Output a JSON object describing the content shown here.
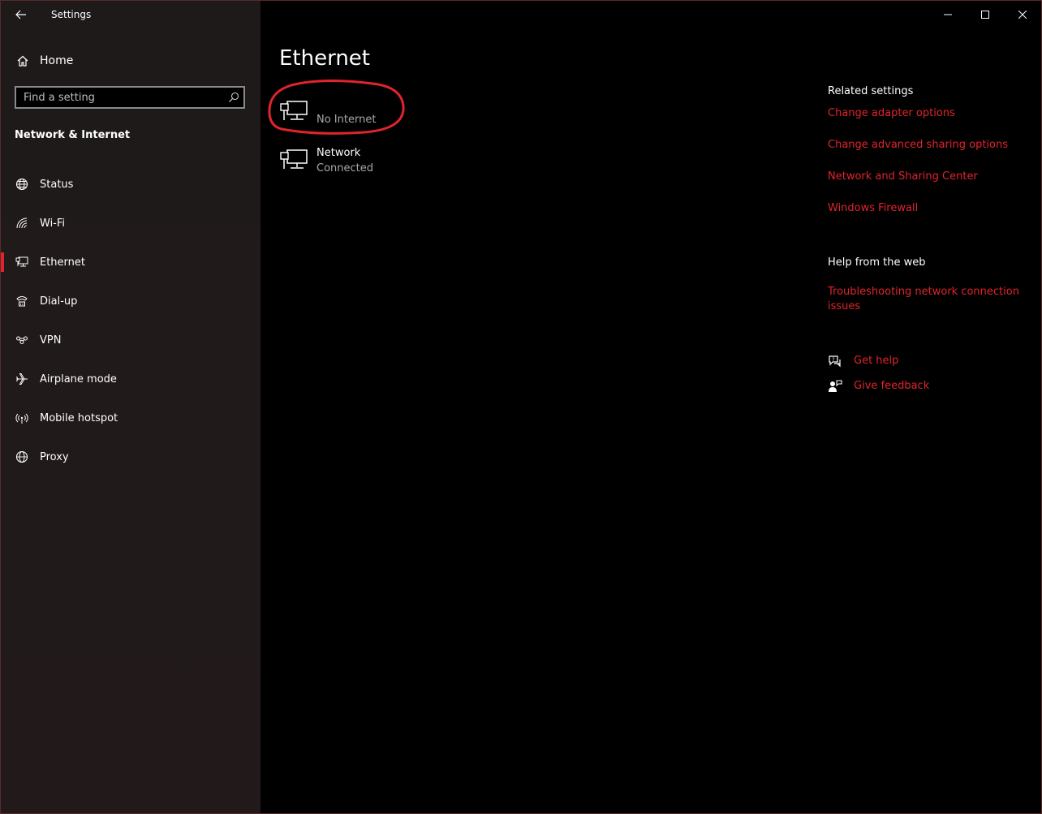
{
  "app": {
    "title": "Settings"
  },
  "sidebar": {
    "home_label": "Home",
    "search_placeholder": "Find a setting",
    "section_title": "Network & Internet",
    "items": [
      {
        "label": "Status",
        "icon": "globe-status-icon",
        "active": false
      },
      {
        "label": "Wi-Fi",
        "icon": "wifi-icon",
        "active": false
      },
      {
        "label": "Ethernet",
        "icon": "ethernet-icon",
        "active": true
      },
      {
        "label": "Dial-up",
        "icon": "dialup-icon",
        "active": false
      },
      {
        "label": "VPN",
        "icon": "vpn-icon",
        "active": false
      },
      {
        "label": "Airplane mode",
        "icon": "airplane-icon",
        "active": false
      },
      {
        "label": "Mobile hotspot",
        "icon": "hotspot-icon",
        "active": false
      },
      {
        "label": "Proxy",
        "icon": "globe-icon",
        "active": false
      }
    ]
  },
  "main": {
    "title": "Ethernet",
    "adapters": [
      {
        "name": "",
        "status": "No Internet"
      },
      {
        "name": "Network",
        "status": "Connected"
      }
    ]
  },
  "related": {
    "heading": "Related settings",
    "links": [
      "Change adapter options",
      "Change advanced sharing options",
      "Network and Sharing Center",
      "Windows Firewall"
    ]
  },
  "help": {
    "heading": "Help from the web",
    "link": "Troubleshooting network connection issues",
    "get_help": "Get help",
    "give_feedback": "Give feedback"
  },
  "colors": {
    "accent": "#e0242b",
    "sidebar_bg": "#201a1a",
    "main_bg": "#000000",
    "muted_text": "#a8a8a8"
  }
}
